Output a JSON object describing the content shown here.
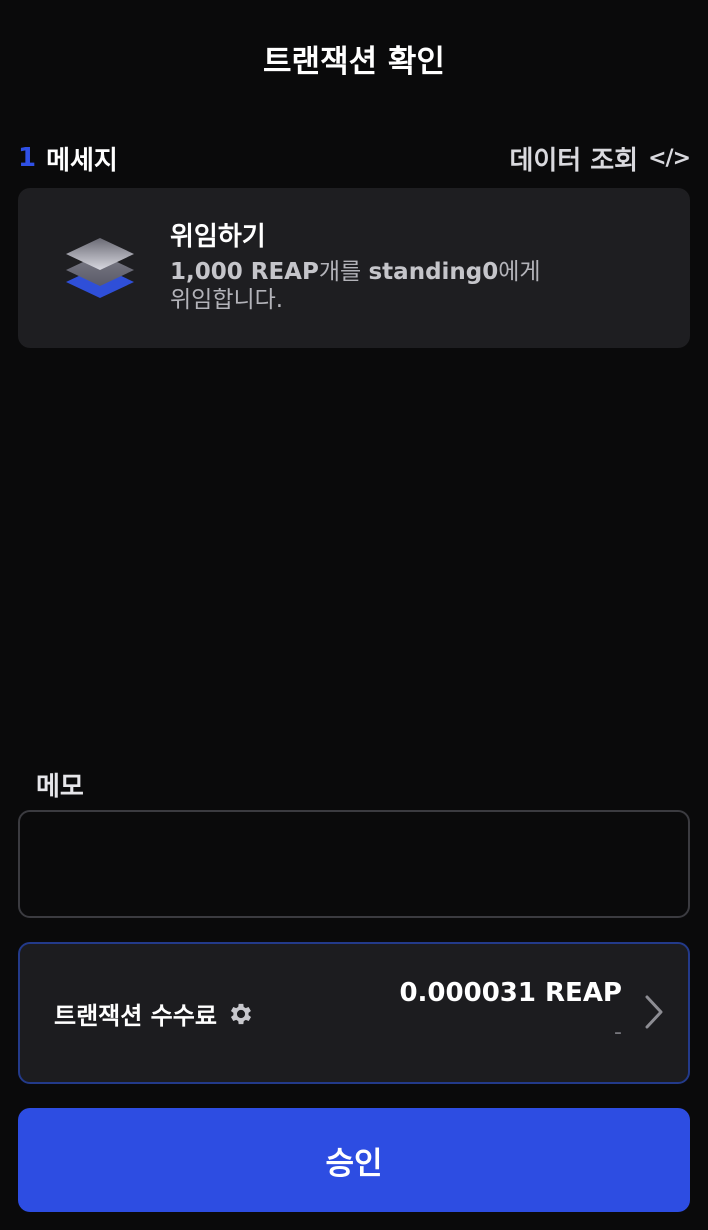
{
  "header": {
    "title": "트랜잭션 확인"
  },
  "messages": {
    "count": "1",
    "label": "메세지",
    "view_data_label": "데이터 조회",
    "items": [
      {
        "icon": "layers-icon",
        "title": "위임하기",
        "amount": "1,000 REAP",
        "desc_mid": "개를 ",
        "validator": "standing0",
        "desc_end": "에게",
        "desc_line2": "위임합니다."
      }
    ]
  },
  "memo": {
    "label": "메모",
    "value": "",
    "placeholder": ""
  },
  "fee": {
    "label": "트랜잭션 수수료",
    "amount": "0.000031 REAP",
    "sub": "-"
  },
  "approve_button": {
    "label": "승인"
  },
  "colors": {
    "background": "#0a0a0b",
    "card": "#1e1e21",
    "accent": "#2d4de2",
    "count": "#2f50e6"
  }
}
